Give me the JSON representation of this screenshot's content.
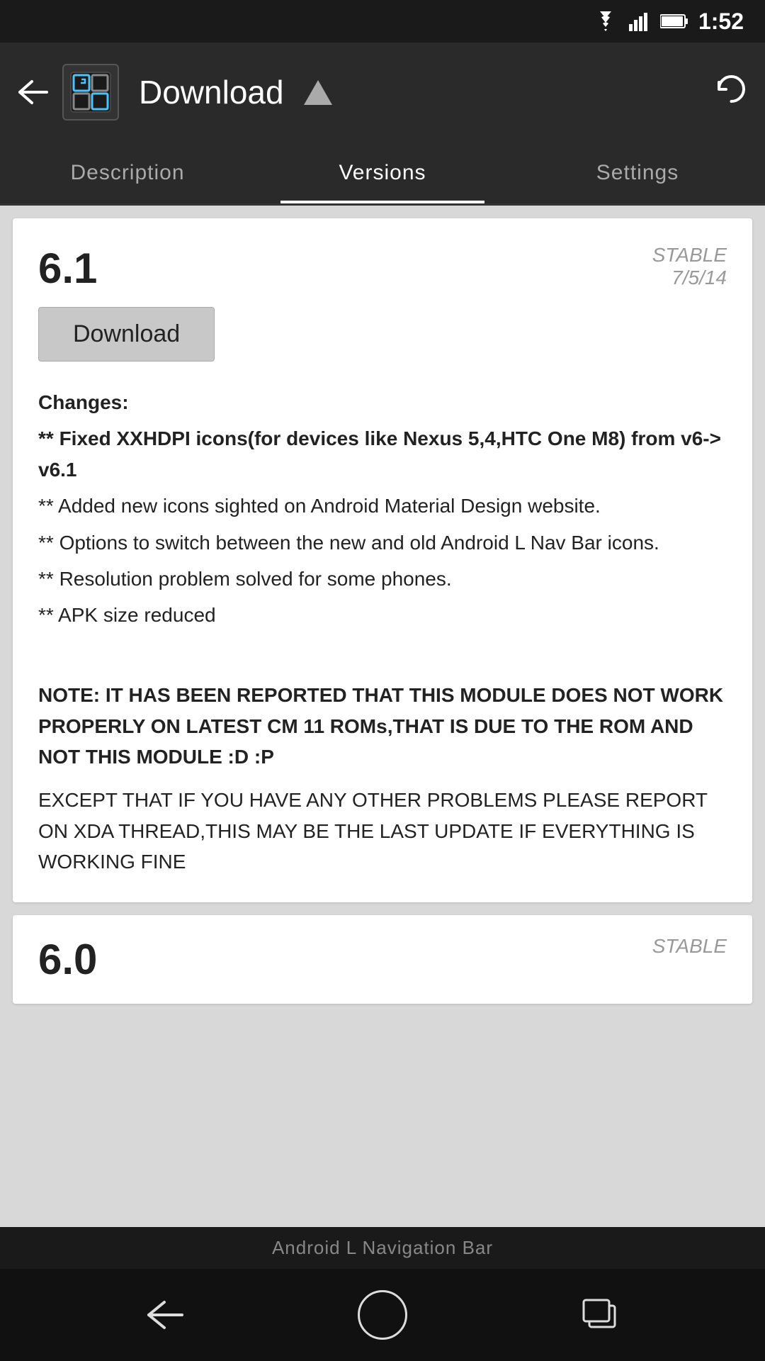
{
  "statusBar": {
    "time": "1:52"
  },
  "appBar": {
    "title": "Download",
    "refreshLabel": "refresh"
  },
  "tabs": [
    {
      "id": "description",
      "label": "Description",
      "active": false
    },
    {
      "id": "versions",
      "label": "Versions",
      "active": true
    },
    {
      "id": "settings",
      "label": "Settings",
      "active": false
    }
  ],
  "versionCard": {
    "version": "6.1",
    "badge": "STABLE",
    "date": "7/5/14",
    "downloadLabel": "Download",
    "changesHeading": "Changes:",
    "line1": "** Fixed XXHDPI icons(for devices like Nexus 5,4,HTC One M8) from v6-> v6.1",
    "line2": "** Added new icons sighted on Android Material Design website.",
    "line3": "** Options to switch between the new and old Android L Nav Bar icons.",
    "line4": "** Resolution problem solved for some phones.",
    "line5": "** APK size reduced",
    "note": "NOTE: IT HAS BEEN REPORTED THAT THIS MODULE DOES NOT WORK PROPERLY ON LATEST CM 11 ROMs,THAT IS DUE TO THE ROM AND NOT THIS MODULE :D :P",
    "extra": "EXCEPT THAT IF YOU HAVE ANY OTHER PROBLEMS PLEASE REPORT ON XDA THREAD,THIS MAY BE THE LAST UPDATE IF EVERYTHING IS WORKING FINE"
  },
  "versionCardPartial": {
    "version": "6.0",
    "badge": "STABLE"
  },
  "navBarLabel": "Android L Navigation Bar"
}
